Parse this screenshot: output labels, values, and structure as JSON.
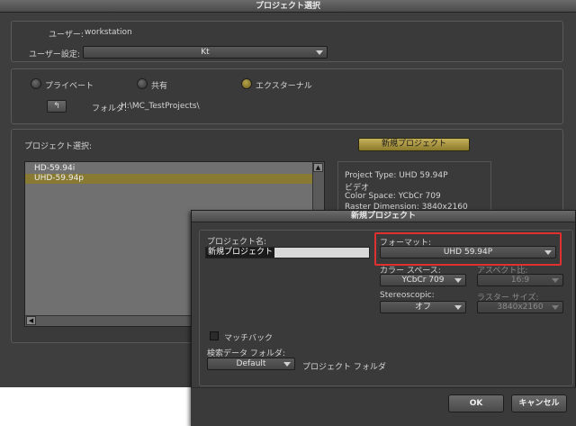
{
  "main_window": {
    "title": "プロジェクト選択",
    "user_label": "ユーザー:",
    "user_value": "workstation",
    "user_settings_label": "ユーザー設定:",
    "user_settings_value": "Kt",
    "radio_private": "プライベート",
    "radio_shared": "共有",
    "radio_external": "エクスターナル",
    "folder_label": "フォルダ:",
    "folder_value": "H:\\MC_TestProjects\\",
    "browse_button": "↰",
    "project_select_label": "プロジェクト選択:",
    "new_project_button": "新規プロジェクト",
    "projects": [
      "HD-59.94i",
      "UHD-59.94p"
    ],
    "selected_project": "UHD-59.94p",
    "info": {
      "project_type": "Project Type: UHD 59.94P",
      "video": "ビデオ",
      "color_space": "Color Space: YCbCr 709",
      "raster_dimension": "Raster Dimension: 3840x2160"
    }
  },
  "dialog": {
    "title": "新規プロジェクト",
    "project_name_label": "プロジェクト名:",
    "project_name_value": "新規プロジェクト",
    "format_label": "フォーマット:",
    "format_value": "UHD 59.94P",
    "color_space_label": "カラー スペース:",
    "color_space_value": "YCbCr 709",
    "aspect_label": "アスペクト比:",
    "aspect_value": "16:9",
    "stereoscopic_label": "Stereoscopic:",
    "stereoscopic_value": "オフ",
    "raster_size_label": "ラスター サイズ:",
    "raster_size_value": "3840x2160",
    "match_back_label": "マッチバック",
    "search_folder_label": "検索データ フォルダ:",
    "search_folder_value": "Default",
    "project_folder_label": "プロジェクト フォルダ",
    "ok_button": "OK",
    "cancel_button": "キャンセル"
  },
  "colors": {
    "accent_gold": "#c7b25a",
    "selection": "#887a32",
    "highlight_red": "#e03030"
  }
}
